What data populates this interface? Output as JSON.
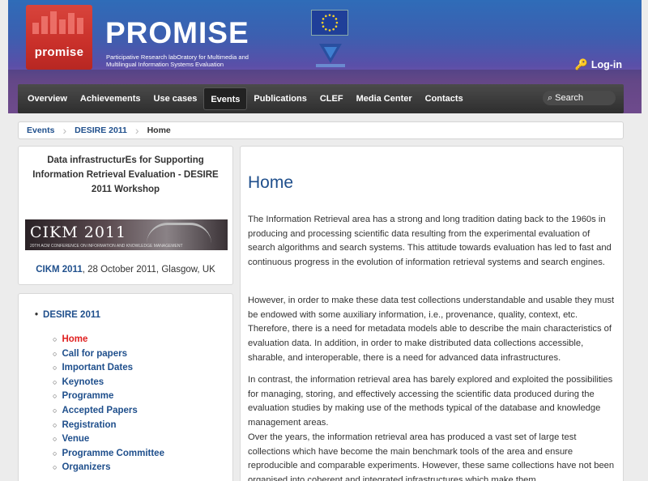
{
  "header": {
    "logo_text": "promise",
    "title": "PROMISE",
    "subtitle": "Participative Research labOratory for Multimedia and Multilingual Information Systems Evaluation",
    "login_label": "Log-in",
    "flag_icon": "eu-flag-icon",
    "fp7_icon": "fp7-logo-icon"
  },
  "nav": {
    "items": [
      "Overview",
      "Achievements",
      "Use cases",
      "Events",
      "Publications",
      "CLEF",
      "Media Center",
      "Contacts"
    ],
    "active": "Events",
    "search_placeholder": "Search"
  },
  "breadcrumb": [
    "Events",
    "DESIRE 2011",
    "Home"
  ],
  "sidebar": {
    "event_title": "Data infrastructurEs for Supporting Information Retrieval Evaluation - DESIRE 2011 Workshop",
    "banner_text": "CIKM 2011",
    "banner_subtext": "20TH ACM CONFERENCE ON INFORMATION AND KNOWLEDGE MANAGEMENT",
    "caption_link": "CIKM 2011",
    "caption_rest": ", 28 October 2011, Glasgow, UK",
    "menu_root": "DESIRE 2011",
    "menu_items": [
      "Home",
      "Call for papers",
      "Important Dates",
      "Keynotes",
      "Programme",
      "Accepted Papers",
      "Registration",
      "Venue",
      "Programme Committee",
      "Organizers"
    ],
    "current_item": "Home"
  },
  "main": {
    "heading": "Home",
    "paragraphs": [
      "The Information Retrieval area has a strong and long tradition dating back to the 1960s in producing and processing scientific data resulting from the experimental evaluation of search algorithms and search systems. This attitude towards evaluation has led to fast and continuous progress in the evolution of information retrieval systems and search engines.",
      "However, in order to make these data test collections understandable and usable they must be endowed with some auxiliary information, i.e., provenance, quality, context, etc. Therefore, there is a need for metadata models able to describe the main characteristics of evaluation data. In addition, in order to make distributed data collections accessible, sharable, and interoperable, there is a need for advanced data infrastructures.",
      "In contrast, the information retrieval area has barely explored and exploited the possibilities for managing, storing, and effectively accessing the scientific data produced during the evaluation studies by making use of the methods typical of the database and knowledge management areas.",
      "Over the years, the information retrieval area has produced a vast set of large test collections which have become the main benchmark tools of the area and ensure reproducible and comparable experiments. However, these same collections have not been organised into coherent and integrated infrastructures which make them"
    ]
  },
  "colors": {
    "link": "#1f4f8c",
    "current": "#e02020",
    "logo": "#c9302a"
  }
}
